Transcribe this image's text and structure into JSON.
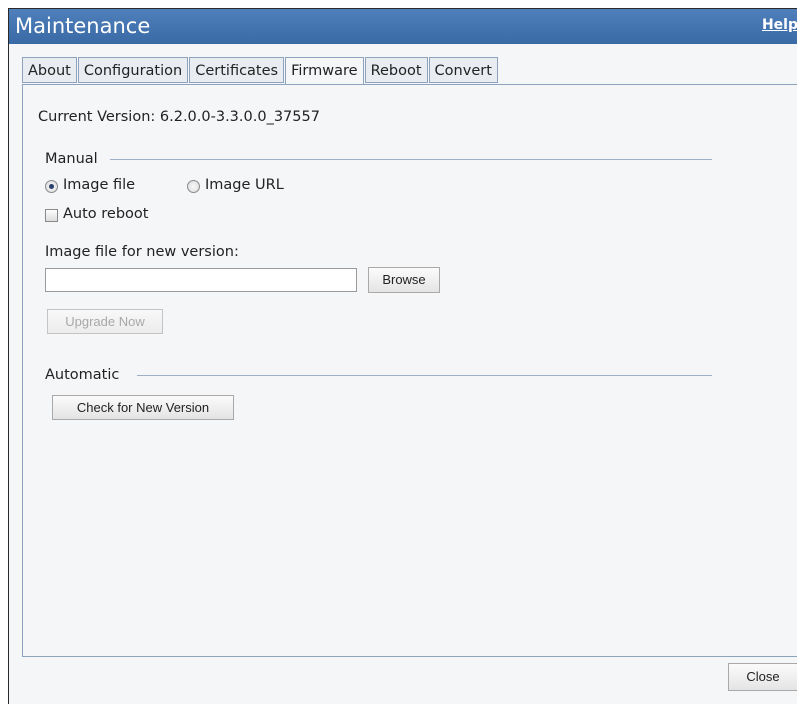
{
  "window": {
    "title": "Maintenance",
    "help_link": "Help"
  },
  "tabs": [
    {
      "label": "About",
      "active": false
    },
    {
      "label": "Configuration",
      "active": false
    },
    {
      "label": "Certificates",
      "active": false
    },
    {
      "label": "Firmware",
      "active": true
    },
    {
      "label": "Reboot",
      "active": false
    },
    {
      "label": "Convert",
      "active": false
    }
  ],
  "firmware": {
    "current_version": "Current Version: 6.2.0.0-3.3.0.0_37557",
    "manual": {
      "legend": "Manual",
      "radio_image_file": "Image file",
      "radio_image_url": "Image URL",
      "selected_source": "Image file",
      "auto_reboot_label": "Auto reboot",
      "auto_reboot_checked": false,
      "file_label": "Image file for new version:",
      "file_value": "",
      "browse_label": "Browse",
      "upgrade_label": "Upgrade Now",
      "upgrade_enabled": false
    },
    "automatic": {
      "legend": "Automatic",
      "check_label": "Check for New Version"
    }
  },
  "footer": {
    "close_label": "Close"
  }
}
